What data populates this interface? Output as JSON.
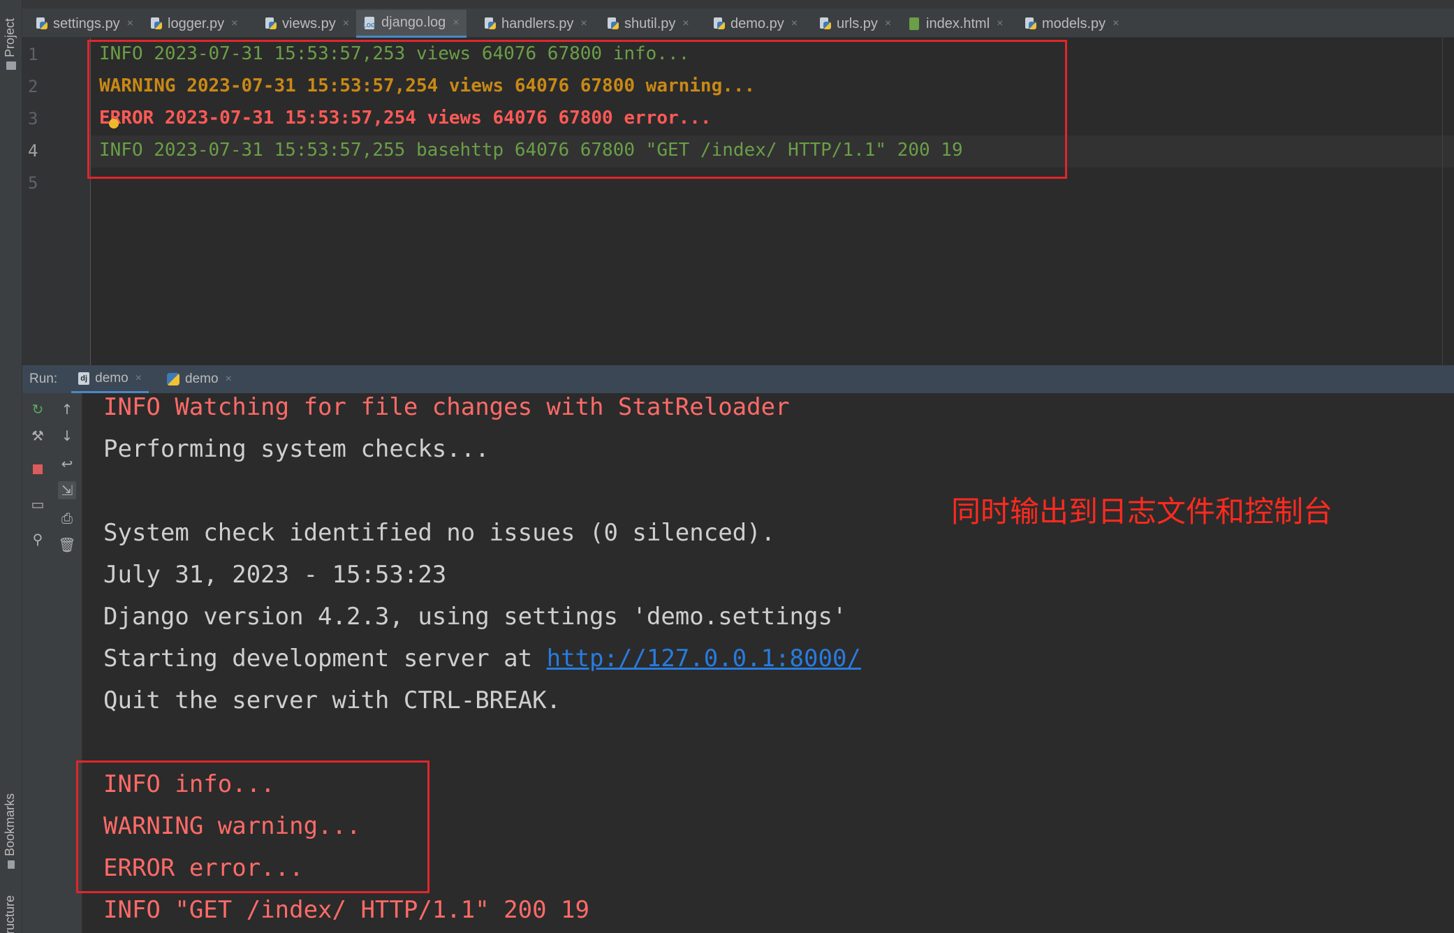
{
  "sidebar": {
    "project_label": "Project",
    "bookmarks_label": "Bookmarks",
    "structure_label": "ructure"
  },
  "tabs": [
    {
      "label": "settings.py",
      "icon": "python-file-icon"
    },
    {
      "label": "logger.py",
      "icon": "python-file-icon"
    },
    {
      "label": "views.py",
      "icon": "python-file-icon"
    },
    {
      "label": "django.log",
      "icon": "log-file-icon",
      "active": true
    },
    {
      "label": "handlers.py",
      "icon": "python-file-icon"
    },
    {
      "label": "shutil.py",
      "icon": "python-file-icon"
    },
    {
      "label": "demo.py",
      "icon": "python-file-icon"
    },
    {
      "label": "urls.py",
      "icon": "python-file-icon"
    },
    {
      "label": "index.html",
      "icon": "html-file-icon"
    },
    {
      "label": "models.py",
      "icon": "python-file-icon"
    }
  ],
  "editor": {
    "line_numbers": [
      "1",
      "2",
      "3",
      "4",
      "5"
    ],
    "lines": [
      {
        "text": "INFO 2023-07-31 15:53:57,253 views 64076 67800 info...",
        "color": "#6a9f47"
      },
      {
        "text": "WARNING 2023-07-31 15:53:57,254 views 64076 67800 warning...",
        "color": "#c98915"
      },
      {
        "text": "ERROR 2023-07-31 15:53:57,254 views 64076 67800 error...",
        "color": "#ff5a56"
      },
      {
        "text": "INFO 2023-07-31 15:53:57,255 basehttp 64076 67800 \"GET /index/ HTTP/1.1\" 200 19",
        "color": "#6a9f47"
      }
    ]
  },
  "run": {
    "label": "Run:",
    "tabs": [
      {
        "label": "demo",
        "icon": "django-icon",
        "active": true
      },
      {
        "label": "demo",
        "icon": "python-icon"
      }
    ]
  },
  "console": {
    "lines": [
      "INFO Watching for file changes with StatReloader",
      "Performing system checks...",
      "System check identified no issues (0 silenced).",
      "July 31, 2023 - 15:53:23",
      "Django version 4.2.3, using settings 'demo.settings'",
      "Starting development server at ",
      "Quit the server with CTRL-BREAK.",
      "INFO info...",
      "WARNING warning...",
      "ERROR error...",
      "INFO \"GET /index/ HTTP/1.1\" 200 19"
    ],
    "server_url": "http://127.0.0.1:8000/"
  },
  "annotation": "同时输出到日志文件和控制台",
  "colors": {
    "info_green": "#6a9f47",
    "warning_orange": "#c98915",
    "error_red": "#ff5a56",
    "console_red": "#ff6b68",
    "highlight_box": "#e0262b",
    "link_blue": "#287bde"
  }
}
